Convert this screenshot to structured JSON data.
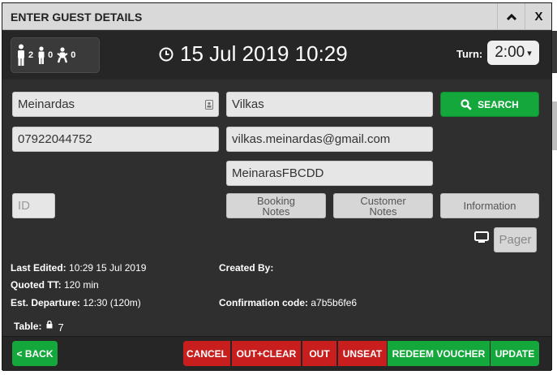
{
  "window": {
    "title": "ENTER GUEST DETAILS",
    "collapse_icon": "chevron-up-icon",
    "close_label": "X"
  },
  "guests": {
    "adults": "2",
    "children": "0",
    "babies": "0"
  },
  "datetime": {
    "clock_icon": "clock-icon",
    "value": "15 Jul 2019 10:29"
  },
  "turn": {
    "label": "Turn:",
    "value": "2:00",
    "arrow": "▾"
  },
  "form": {
    "first_name": "Meinardas",
    "last_name": "Vilkas",
    "phone": "07922044752",
    "email": "vilkas.meinardas@gmail.com",
    "company": "MeinarasFBCDD",
    "id_placeholder": "ID"
  },
  "buttons": {
    "search": "SEARCH",
    "booking_notes": "Booking Notes",
    "customer_notes": "Customer Notes",
    "information": "Information",
    "pager": "Pager"
  },
  "info": {
    "last_edited_label": "Last Edited:",
    "last_edited_value": "10:29 15 Jul 2019",
    "created_by_label": "Created By:",
    "created_by_value": "",
    "quoted_tt_label": "Quoted TT:",
    "quoted_tt_value": "120 min",
    "est_departure_label": "Est. Departure:",
    "est_departure_value": "12:30 (120m)",
    "confirmation_label": "Confirmation code:",
    "confirmation_value": "a7b5b6fe6",
    "table_label": "Table:",
    "table_value": "7"
  },
  "footer": {
    "back": "< BACK",
    "cancel": "CANCEL",
    "out_clear": "OUT+CLEAR",
    "out": "OUT",
    "unseat": "UNSEAT",
    "redeem": "REDEEM VOUCHER",
    "update": "UPDATE"
  },
  "colors": {
    "green": "#14a83c",
    "red": "#c81e1e",
    "dark": "#2f2f2f"
  }
}
